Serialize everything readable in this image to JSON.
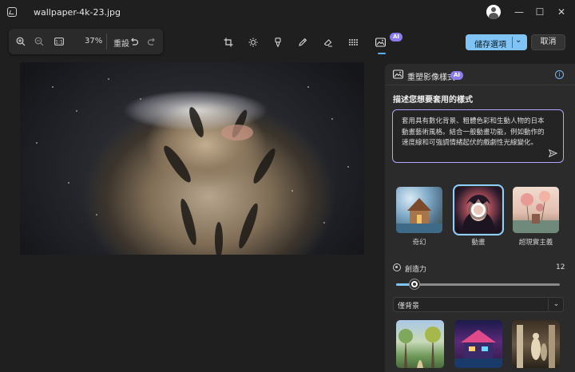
{
  "window": {
    "title": "wallpaper-4k-23.jpg",
    "minimize": "—",
    "maximize": "☐",
    "close": "✕"
  },
  "toolbar": {
    "zoom_level": "37%",
    "reset_label": "重設",
    "ai_badge": "AI"
  },
  "actions": {
    "save_label": "儲存選項",
    "save_chevron": "⌄",
    "cancel_label": "取消"
  },
  "panel": {
    "title": "重塑影像樣式",
    "ai_badge": "AI",
    "info": "i",
    "prompt_label": "描述您想要套用的樣式",
    "prompt_text": "套用具有數化背景、粗體色彩和生動人物的日本動畫藝術風格。結合一般動畫功能，例如動作的速度線和可強調情緒起伏的戲劇性光線變化。",
    "styles": [
      {
        "label": "奇幻",
        "selected": false
      },
      {
        "label": "動畫",
        "selected": true
      },
      {
        "label": "超現實主義",
        "selected": false
      }
    ],
    "creativity_label": "創造力",
    "creativity_value": "12",
    "creativity_fraction": 0.11,
    "background_select": "僅背景",
    "background_chevron": "⌄"
  },
  "colors": {
    "accent": "#7fc4f5",
    "ai_purple": "#8a7cf0",
    "prompt_border": "#b6a3ff"
  }
}
